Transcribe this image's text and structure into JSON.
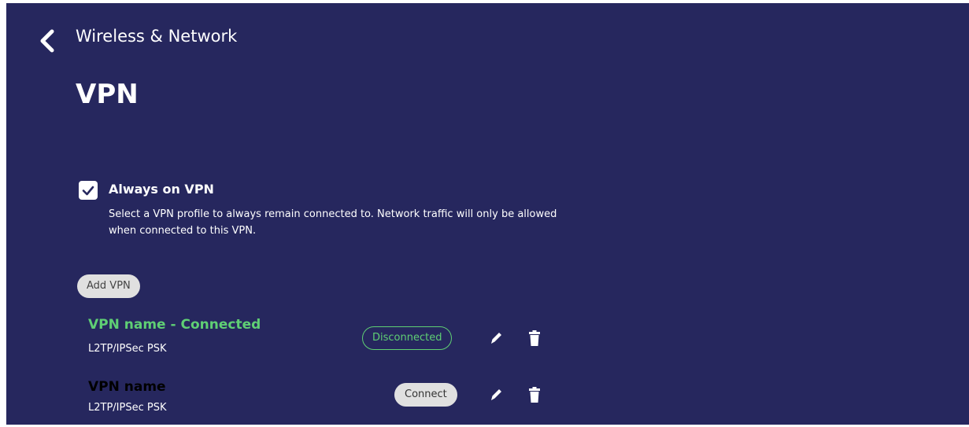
{
  "header": {
    "breadcrumb": "Wireless & Network",
    "title": "VPN",
    "back_icon": "chevron-left-icon"
  },
  "always_on": {
    "checked": true,
    "label": "Always on VPN",
    "description": "Select a VPN profile to always remain connected to. Network traffic will only be allowed when connected to this VPN."
  },
  "add_vpn_label": "Add VPN",
  "vpn_list": [
    {
      "name": "VPN name - Connected",
      "type": "L2TP/IPSec PSK",
      "action_label": "Disconnected",
      "name_color": "#5fcf74",
      "edit_icon": "pencil-icon",
      "delete_icon": "trash-icon"
    },
    {
      "name": "VPN name",
      "type": "L2TP/IPSec PSK",
      "action_label": "Connect",
      "name_color": "#ffffff",
      "edit_icon": "pencil-icon",
      "delete_icon": "trash-icon"
    }
  ],
  "colors": {
    "background": "#26275e",
    "accent_green": "#5fcf74",
    "pill_grey": "#e0e0e0",
    "text": "#ffffff"
  }
}
